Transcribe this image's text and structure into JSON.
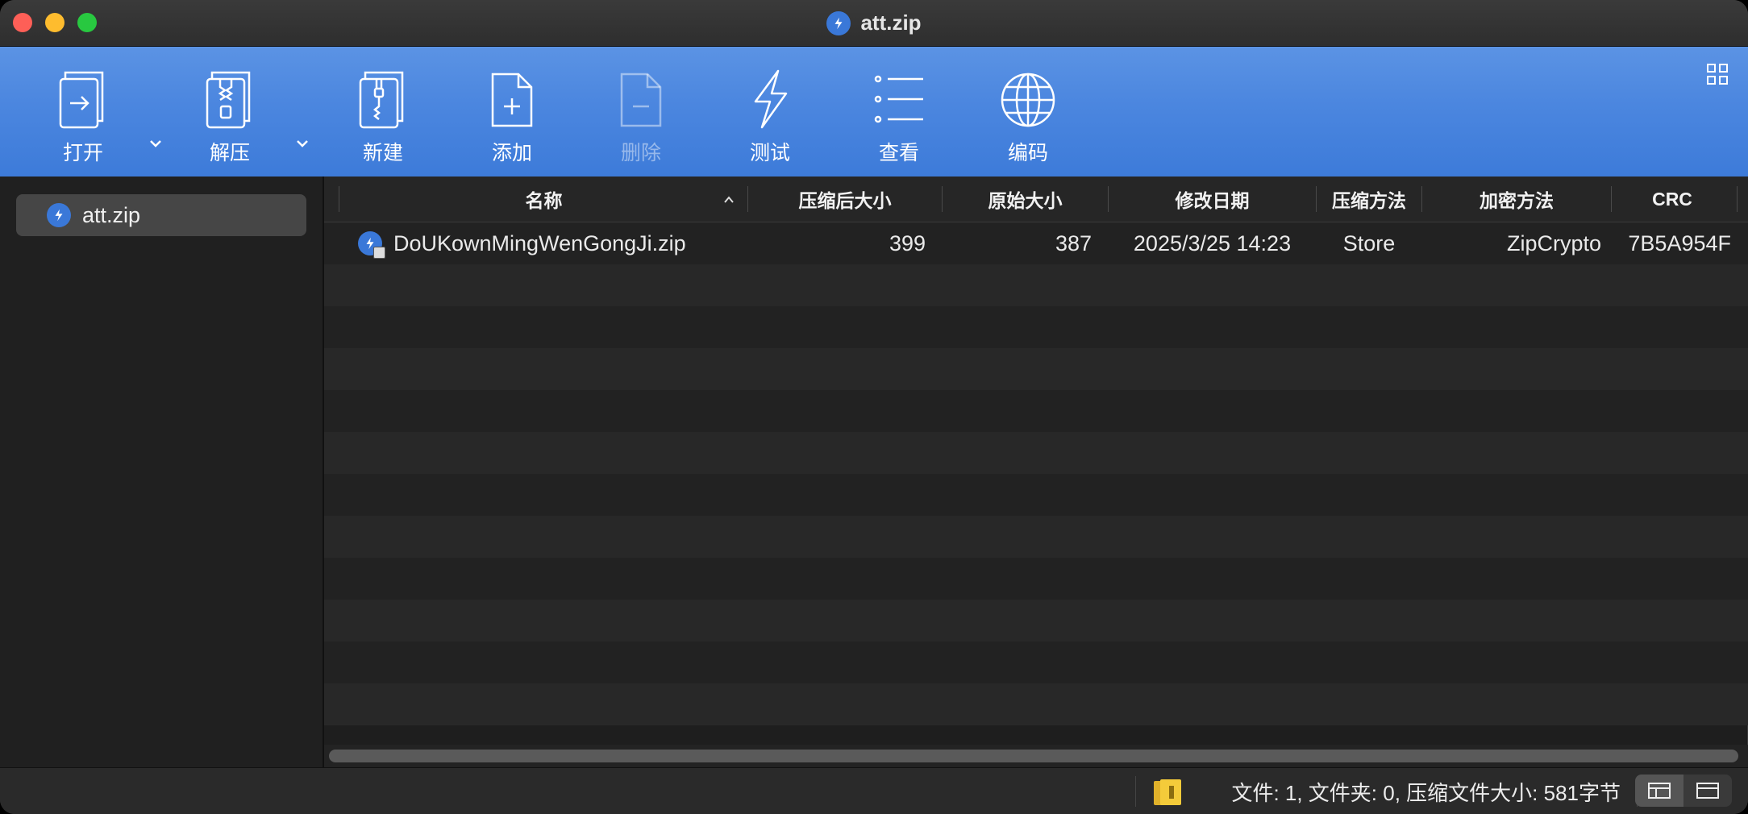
{
  "window": {
    "title": "att.zip"
  },
  "toolbar": {
    "items": [
      {
        "label": "打开",
        "icon": "open-icon"
      },
      {
        "label": "解压",
        "icon": "extract-icon"
      },
      {
        "label": "新建",
        "icon": "new-archive-icon"
      },
      {
        "label": "添加",
        "icon": "add-file-icon"
      },
      {
        "label": "删除",
        "icon": "delete-file-icon",
        "disabled": true
      },
      {
        "label": "测试",
        "icon": "lightning-icon"
      },
      {
        "label": "查看",
        "icon": "list-icon"
      },
      {
        "label": "编码",
        "icon": "globe-icon"
      }
    ]
  },
  "sidebar": {
    "items": [
      {
        "label": "att.zip",
        "selected": true
      }
    ]
  },
  "table": {
    "columns": [
      "名称",
      "压缩后大小",
      "原始大小",
      "修改日期",
      "压缩方法",
      "加密方法",
      "CRC"
    ],
    "sort": {
      "column": "名称",
      "direction": "ascending"
    },
    "rows": [
      {
        "name": "DoUKownMingWenGongJi.zip",
        "compressed": "399",
        "original": "387",
        "modified": "2025/3/25 14:23",
        "method": "Store",
        "encryption": "ZipCrypto",
        "crc": "7B5A954F"
      }
    ]
  },
  "status": {
    "summary": "文件: 1, 文件夹: 0, 压缩文件大小: 581字节"
  },
  "colors": {
    "accent": "#4a86df",
    "background": "#1e1e1e"
  }
}
